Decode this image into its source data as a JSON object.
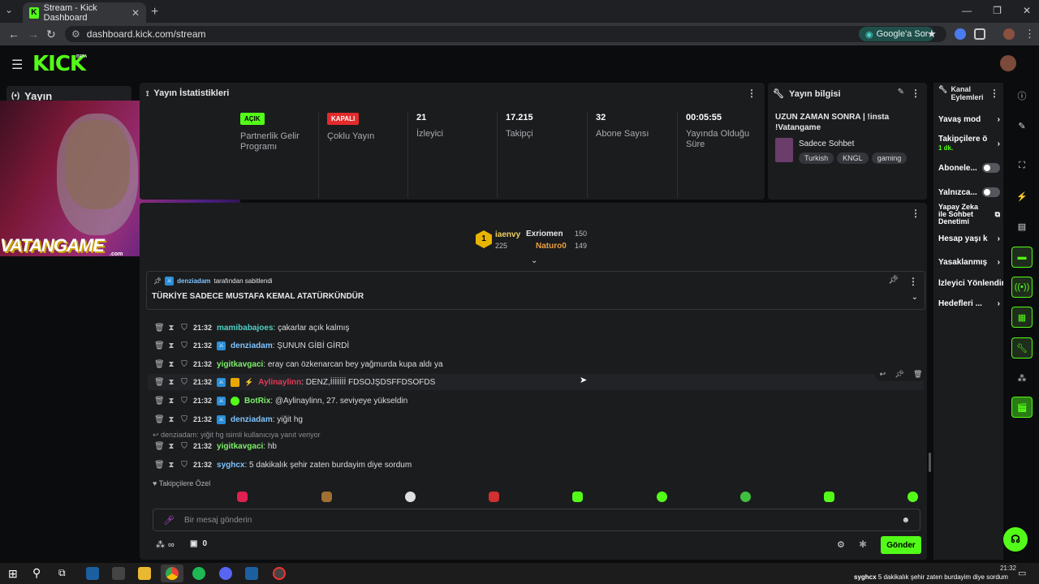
{
  "browser": {
    "tab_title": "Stream - Kick Dashboard",
    "url": "dashboard.kick.com/stream",
    "google_button": "Google'a Sor"
  },
  "kick": {
    "logo": "KICK",
    "beta": "BETA"
  },
  "sidebar": {
    "stream_label": "Yayın"
  },
  "overlay": {
    "brand": "VATANGAME",
    "brand_suffix": ".com"
  },
  "stats": {
    "title": "Yayın İstatistikleri",
    "cells": [
      {
        "value": "AÇIK",
        "label": "Partnerlik Gelir Programı"
      },
      {
        "value": "KAPALI",
        "label": "Çoklu Yayın"
      },
      {
        "value": "21",
        "label": "İzleyici"
      },
      {
        "value": "17.215",
        "label": "Takipçi"
      },
      {
        "value": "32",
        "label": "Abone Sayısı"
      },
      {
        "value": "00:05:55",
        "label": "Yayında Olduğu Süre"
      }
    ]
  },
  "info": {
    "title": "Yayın bilgisi",
    "stream_title": "UZUN ZAMAN SONRA | !insta !Vatangame",
    "category": "Sadece Sohbet",
    "tags": [
      "Turkish",
      "KNGL",
      "gaming"
    ]
  },
  "leaderboard": {
    "first_name": "iaenvy",
    "first_count": "225",
    "second_name": "Exriomen",
    "second_count": "150",
    "third_name": "Naturo0",
    "third_count": "149"
  },
  "pinned": {
    "by_user": "denziadam",
    "by_text": "tarafından sabitlendi",
    "message": "TÜRKİYE SADECE MUSTAFA KEMAL ATATÜRKÜNDÜR"
  },
  "messages": [
    {
      "time": "21:32",
      "user": "mamibabajoes",
      "color": "#4fd0c5",
      "text": ": çakarlar açık kalmış"
    },
    {
      "time": "21:32",
      "user": "denziadam",
      "color": "#7fc4ff",
      "text": ": ŞUNUN GİBİ GİRDİ"
    },
    {
      "time": "21:32",
      "user": "yigitkavgaci",
      "color": "#7df06a",
      "text": ": eray can özkenarcan bey yağmurda kupa aldı ya"
    },
    {
      "time": "21:32",
      "user": "Aylinaylinn",
      "color": "#e23b5a",
      "text": ": DENZ,İİİİİİİ FDSOJŞDSFFDSOFDS"
    },
    {
      "time": "21:32",
      "user": "BotRix",
      "color": "#7df06a",
      "text": ": @Aylinaylinn, 27. seviyeye yükseldin"
    },
    {
      "time": "21:32",
      "user": "denziadam",
      "color": "#7fc4ff",
      "text": ": yiğit hg"
    },
    {
      "time": "21:32",
      "user": "yigitkavgaci",
      "color": "#7df06a",
      "text": ": hb"
    },
    {
      "time": "21:32",
      "user": "syghcx",
      "color": "#7fc4ff",
      "text": ": 5 dakikalık şehir zaten burdayim diye sordum"
    }
  ],
  "reply_note": "denziadam: yiğit hg isimli kullanıcıya yanıt veriyor",
  "emote_section": "Takipçilere Özel",
  "composer": {
    "placeholder": "Bir mesaj gönderin",
    "send": "Gönder",
    "points": "∞",
    "store": "0"
  },
  "kanal": {
    "title": "Kanal Eylemleri",
    "items": [
      {
        "label": "Yavaş mod"
      },
      {
        "label": "Takipçilere ö",
        "sub": "1 dk."
      },
      {
        "label": "Abonele..."
      },
      {
        "label": "Yalnızca..."
      },
      {
        "label": "Yapay Zeka ile Sohbet Denetimi"
      },
      {
        "label": "Hesap yaşı k"
      },
      {
        "label": "Yasaklanmış"
      },
      {
        "label": "İzleyici Yönlendir"
      },
      {
        "label": "Hedefleri ..."
      }
    ]
  },
  "taskbar": {
    "clock": "21:32",
    "ticker_user": "syghcx",
    "ticker_text": "5 dakikalık şehir zaten burdayim diye sordum"
  }
}
